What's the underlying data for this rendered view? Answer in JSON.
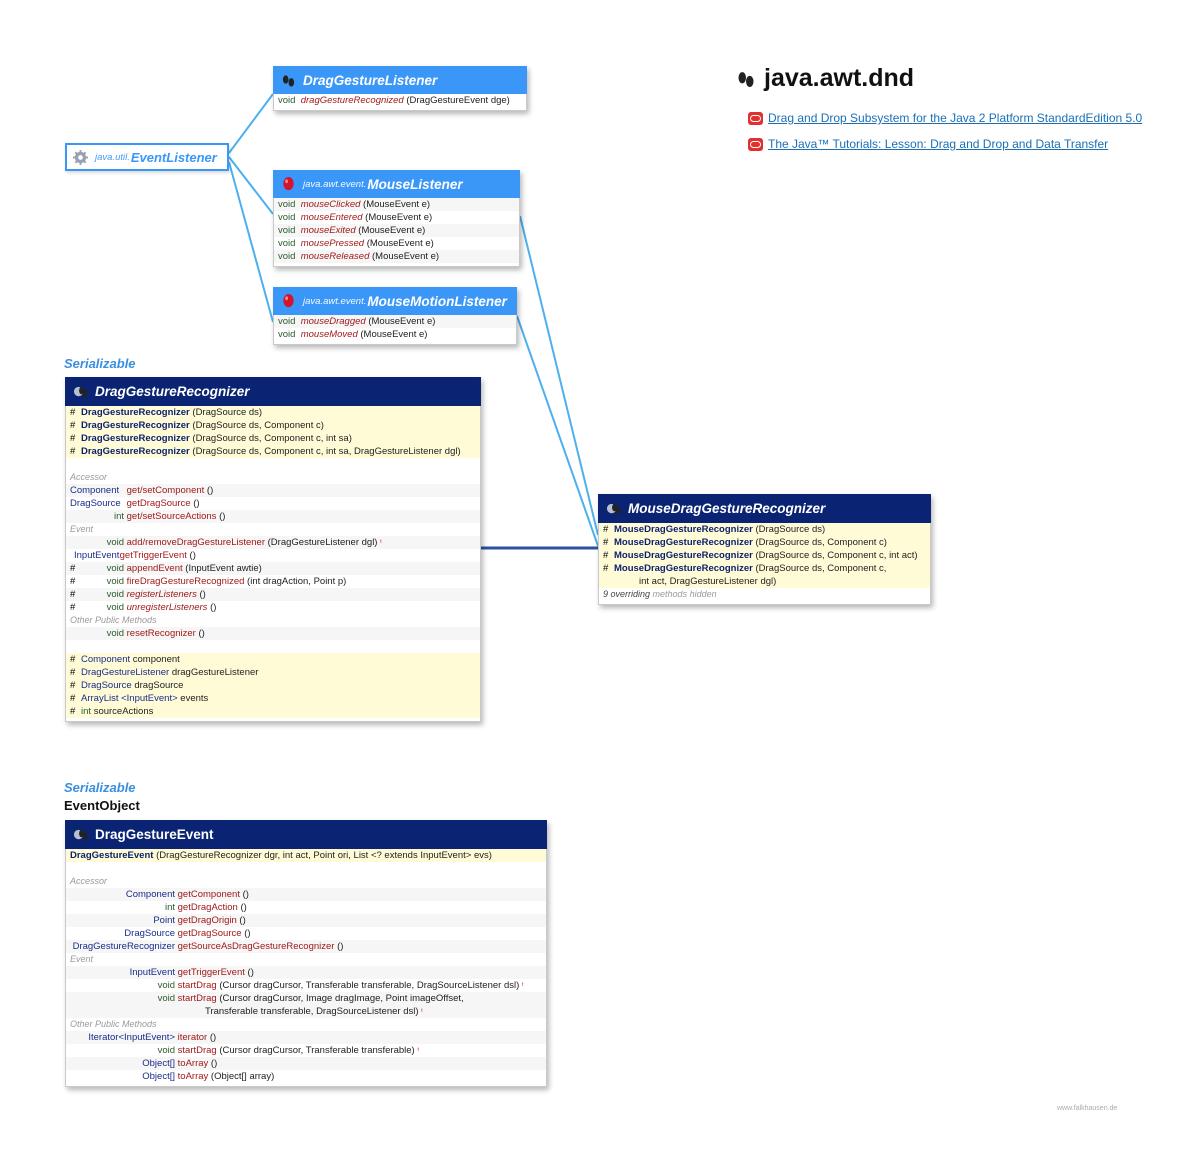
{
  "title": {
    "package": "java.awt.dnd"
  },
  "references": [
    {
      "label": "Drag and Drop Subsystem for the Java 2 Platform StandardEdition 5.0"
    },
    {
      "label": "The Java™ Tutorials: Lesson: Drag and Drop and Data Transfer"
    }
  ],
  "event_listener": {
    "package": "java.util.",
    "name": "EventListener"
  },
  "drag_gesture_listener": {
    "name": "DragGestureListener",
    "methods": [
      {
        "ret": "void",
        "name": "dragGestureRecognized",
        "params": "(DragGestureEvent dge)"
      }
    ]
  },
  "mouse_listener": {
    "package": "java.awt.event.",
    "name": "MouseListener",
    "methods": [
      {
        "ret": "void",
        "name": "mouseClicked",
        "params": "(MouseEvent e)"
      },
      {
        "ret": "void",
        "name": "mouseEntered",
        "params": "(MouseEvent e)"
      },
      {
        "ret": "void",
        "name": "mouseExited",
        "params": "(MouseEvent e)"
      },
      {
        "ret": "void",
        "name": "mousePressed",
        "params": "(MouseEvent e)"
      },
      {
        "ret": "void",
        "name": "mouseReleased",
        "params": "(MouseEvent e)"
      }
    ]
  },
  "mouse_motion_listener": {
    "package": "java.awt.event.",
    "name": "MouseMotionListener",
    "methods": [
      {
        "ret": "void",
        "name": "mouseDragged",
        "params": "(MouseEvent e)"
      },
      {
        "ret": "void",
        "name": "mouseMoved",
        "params": "(MouseEvent e)"
      }
    ]
  },
  "drag_gesture_recognizer": {
    "stereotype": "Serializable",
    "name": "DragGestureRecognizer",
    "constructors": [
      {
        "mod": "#",
        "name": "DragGestureRecognizer",
        "params": "(DragSource ds)"
      },
      {
        "mod": "#",
        "name": "DragGestureRecognizer",
        "params": "(DragSource ds, Component c)"
      },
      {
        "mod": "#",
        "name": "DragGestureRecognizer",
        "params": "(DragSource ds, Component c, int sa)"
      },
      {
        "mod": "#",
        "name": "DragGestureRecognizer",
        "params": "(DragSource ds, Component c, int sa, DragGestureListener dgl)"
      }
    ],
    "sections": {
      "accessor": "Accessor",
      "event": "Event",
      "other": "Other Public Methods"
    },
    "accessor": [
      {
        "mod": "",
        "ret": "Component",
        "name": "get/setComponent",
        "params": "()"
      },
      {
        "mod": "",
        "ret": "DragSource",
        "name": "getDragSource",
        "params": "()"
      },
      {
        "mod": "",
        "ret": "int",
        "name": "get/setSourceActions",
        "params": "()"
      }
    ],
    "event": [
      {
        "mod": "",
        "ret": "void",
        "name": "add/removeDragGestureListener",
        "params": "(DragGestureListener dgl)",
        "warn": "ᵗ"
      },
      {
        "mod": "",
        "ret": "InputEvent",
        "name": "getTriggerEvent",
        "params": "()"
      },
      {
        "mod": "#",
        "ret": "void",
        "name": "appendEvent",
        "params": "(InputEvent awtie)"
      },
      {
        "mod": "#",
        "ret": "void",
        "name": "fireDragGestureRecognized",
        "params": "(int dragAction, Point p)"
      },
      {
        "mod": "#",
        "ret": "void",
        "name": "registerListeners",
        "params": "()",
        "italic": true
      },
      {
        "mod": "#",
        "ret": "void",
        "name": "unregisterListeners",
        "params": "()",
        "italic": true
      }
    ],
    "other": [
      {
        "mod": "",
        "ret": "void",
        "name": "resetRecognizer",
        "params": "()"
      }
    ],
    "fields": [
      {
        "mod": "#",
        "type": "Component",
        "name": "component"
      },
      {
        "mod": "#",
        "type": "DragGestureListener",
        "name": "dragGestureListener"
      },
      {
        "mod": "#",
        "type": "DragSource",
        "name": "dragSource"
      },
      {
        "mod": "#",
        "type": "ArrayList <InputEvent>",
        "name": "events"
      },
      {
        "mod": "#",
        "type": "int",
        "name": "sourceActions"
      }
    ]
  },
  "mouse_drag_gesture_recognizer": {
    "name": "MouseDragGestureRecognizer",
    "constructors": [
      {
        "mod": "#",
        "name": "MouseDragGestureRecognizer",
        "params": "(DragSource ds)"
      },
      {
        "mod": "#",
        "name": "MouseDragGestureRecognizer",
        "params": "(DragSource ds, Component c)"
      },
      {
        "mod": "#",
        "name": "MouseDragGestureRecognizer",
        "params": "(DragSource ds, Component c, int act)"
      },
      {
        "mod": "#",
        "name": "MouseDragGestureRecognizer",
        "params": "(DragSource ds, Component c,"
      },
      {
        "mod": "",
        "name": "",
        "params": "int act, DragGestureListener dgl)"
      }
    ],
    "note": {
      "count": "9 overriding",
      "rest": "methods hidden"
    }
  },
  "drag_gesture_event": {
    "stereotype": "Serializable",
    "superclass": "EventObject",
    "name": "DragGestureEvent",
    "constructor": {
      "name": "DragGestureEvent",
      "params": "(DragGestureRecognizer dgr, int act, Point ori, List <? extends InputEvent> evs)"
    },
    "sections": {
      "accessor": "Accessor",
      "event": "Event",
      "other": "Other Public Methods"
    },
    "accessor": [
      {
        "ret": "Component",
        "name": "getComponent",
        "params": "()"
      },
      {
        "ret": "int",
        "name": "getDragAction",
        "params": "()"
      },
      {
        "ret": "Point",
        "name": "getDragOrigin",
        "params": "()"
      },
      {
        "ret": "DragSource",
        "name": "getDragSource",
        "params": "()"
      },
      {
        "ret": "DragGestureRecognizer",
        "name": "getSourceAsDragGestureRecognizer",
        "params": "()"
      }
    ],
    "event": [
      {
        "ret": "InputEvent",
        "name": "getTriggerEvent",
        "params": "()"
      },
      {
        "ret": "void",
        "name": "startDrag",
        "params": "(Cursor dragCursor, Transferable transferable, DragSourceListener dsl)",
        "warn": "ᵗ"
      },
      {
        "ret": "void",
        "name": "startDrag",
        "params": "(Cursor dragCursor, Image dragImage, Point imageOffset,"
      },
      {
        "ret": "",
        "name": "",
        "params": "Transferable transferable, DragSourceListener dsl)",
        "warn": "ᵗ"
      }
    ],
    "other": [
      {
        "ret": "Iterator<InputEvent>",
        "name": "iterator",
        "params": "()"
      },
      {
        "ret": "void",
        "name": "startDrag",
        "params": "(Cursor dragCursor, Transferable transferable)",
        "warn": "ᵗ"
      },
      {
        "ret": "Object[]",
        "name": "toArray",
        "params": "()"
      },
      {
        "ret": "Object[]",
        "name": "toArray",
        "params": "(Object[] array)"
      }
    ]
  },
  "footer": "www.falkhausen.de",
  "colors": {
    "light_header": "#3a97f8",
    "dark_header": "#0a2473",
    "ctor_bg": "#fffbd6",
    "link_line": "#4db0ee"
  }
}
